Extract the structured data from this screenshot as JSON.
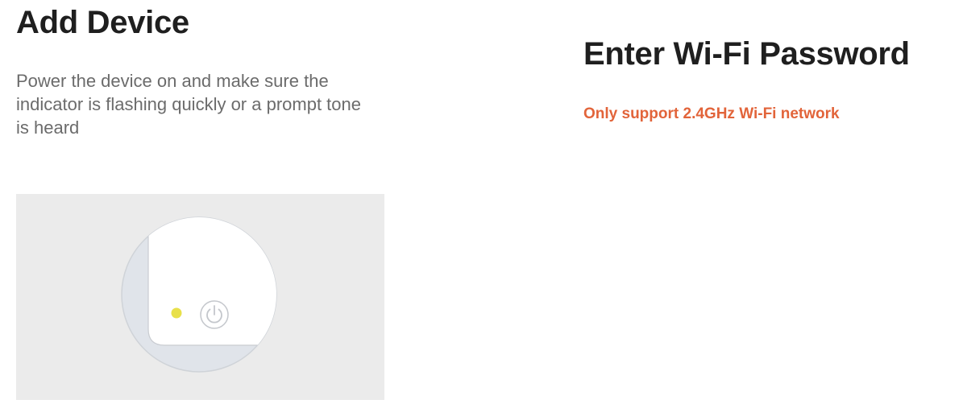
{
  "add_device": {
    "title": "Add Device",
    "instructions": "Power the device on and make sure the indicator is flashing quickly or a prompt tone is heard",
    "illustration": {
      "indicator_color": "#e8e04a",
      "icons": [
        "indicator-light-icon",
        "power-button-icon"
      ]
    }
  },
  "wifi": {
    "title": "Enter Wi-Fi Password",
    "notice": "Only support 2.4GHz Wi-Fi network",
    "notice_color": "#e2643a"
  }
}
